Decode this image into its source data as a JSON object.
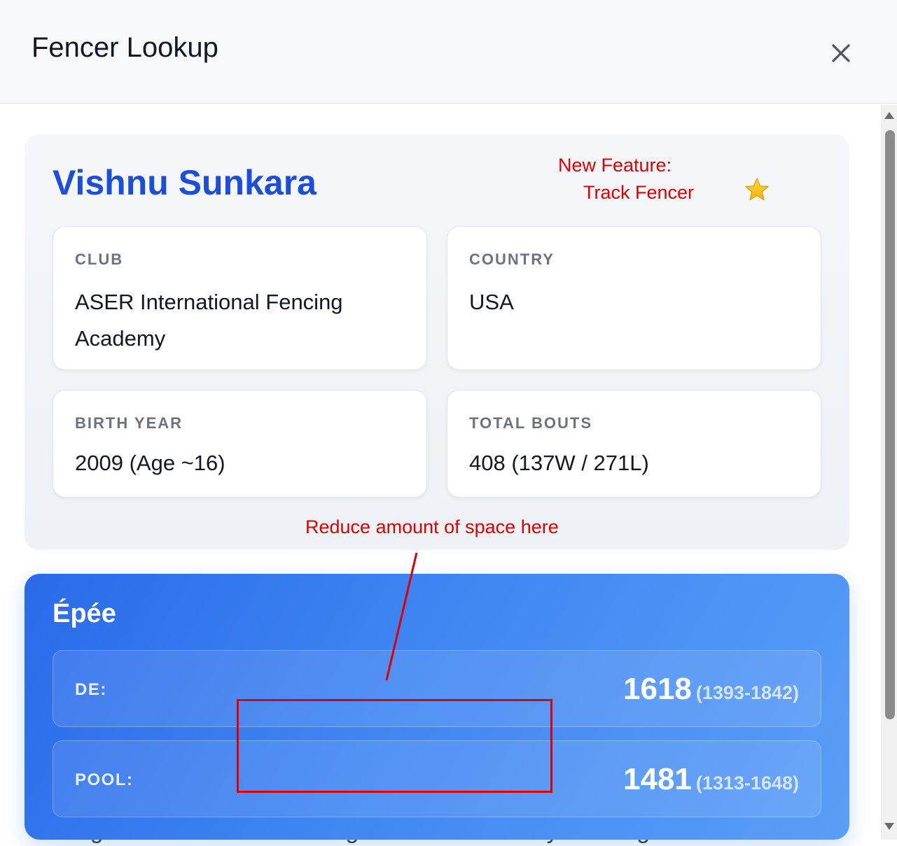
{
  "modal": {
    "title": "Fencer Lookup",
    "close_icon": "close-icon"
  },
  "fencer": {
    "name": "Vishnu Sunkara",
    "track_icon": "star-icon",
    "cards": {
      "club": {
        "label": "CLUB",
        "value": "ASER International Fencing Academy"
      },
      "country": {
        "label": "COUNTRY",
        "value": "USA"
      },
      "birth_year": {
        "label": "BIRTH YEAR",
        "value": "2009 (Age ~16)"
      },
      "total_bouts": {
        "label": "TOTAL BOUTS",
        "value": "408 (137W / 271L)"
      }
    }
  },
  "annotations": {
    "feature_line1": "New Feature:",
    "feature_line2": "Track Fencer",
    "space_note": "Reduce amount of space here",
    "color": "#e00000"
  },
  "weapon": {
    "title": "Épée",
    "ratings": {
      "de": {
        "label": "DE:",
        "value": "1618",
        "range": "(1393-1842)"
      },
      "pool": {
        "label": "POOL:",
        "value": "1481",
        "range": "(1313-1648)"
      }
    }
  },
  "behind_text": "Wangler International Fencing Club / New Jersey Fencing Alliance",
  "colors": {
    "accent": "#1d4ed8",
    "panel_gradient_start": "#2a6aea",
    "panel_gradient_end": "#5b9ef7"
  }
}
